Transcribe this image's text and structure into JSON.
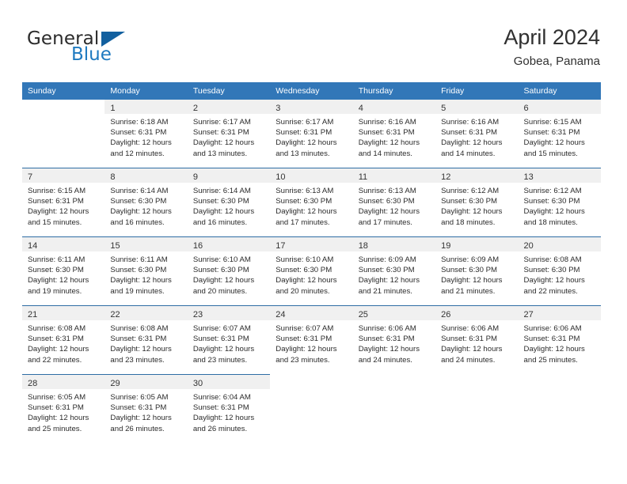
{
  "brand": {
    "name_part1": "General",
    "name_part2": "Blue",
    "triangle_color": "#12609f",
    "blue_color": "#1f7ac0"
  },
  "header": {
    "title": "April 2024",
    "subtitle": "Gobea, Panama"
  },
  "theme": {
    "header_bg": "#3277b8",
    "row_divider": "#2e6da4",
    "daynum_band": "#f0f0f0"
  },
  "columns": [
    "Sunday",
    "Monday",
    "Tuesday",
    "Wednesday",
    "Thursday",
    "Friday",
    "Saturday"
  ],
  "weeks": [
    [
      {
        "day": "",
        "lines": []
      },
      {
        "day": "1",
        "lines": [
          "Sunrise: 6:18 AM",
          "Sunset: 6:31 PM",
          "Daylight: 12 hours",
          "and 12 minutes."
        ]
      },
      {
        "day": "2",
        "lines": [
          "Sunrise: 6:17 AM",
          "Sunset: 6:31 PM",
          "Daylight: 12 hours",
          "and 13 minutes."
        ]
      },
      {
        "day": "3",
        "lines": [
          "Sunrise: 6:17 AM",
          "Sunset: 6:31 PM",
          "Daylight: 12 hours",
          "and 13 minutes."
        ]
      },
      {
        "day": "4",
        "lines": [
          "Sunrise: 6:16 AM",
          "Sunset: 6:31 PM",
          "Daylight: 12 hours",
          "and 14 minutes."
        ]
      },
      {
        "day": "5",
        "lines": [
          "Sunrise: 6:16 AM",
          "Sunset: 6:31 PM",
          "Daylight: 12 hours",
          "and 14 minutes."
        ]
      },
      {
        "day": "6",
        "lines": [
          "Sunrise: 6:15 AM",
          "Sunset: 6:31 PM",
          "Daylight: 12 hours",
          "and 15 minutes."
        ]
      }
    ],
    [
      {
        "day": "7",
        "lines": [
          "Sunrise: 6:15 AM",
          "Sunset: 6:31 PM",
          "Daylight: 12 hours",
          "and 15 minutes."
        ]
      },
      {
        "day": "8",
        "lines": [
          "Sunrise: 6:14 AM",
          "Sunset: 6:30 PM",
          "Daylight: 12 hours",
          "and 16 minutes."
        ]
      },
      {
        "day": "9",
        "lines": [
          "Sunrise: 6:14 AM",
          "Sunset: 6:30 PM",
          "Daylight: 12 hours",
          "and 16 minutes."
        ]
      },
      {
        "day": "10",
        "lines": [
          "Sunrise: 6:13 AM",
          "Sunset: 6:30 PM",
          "Daylight: 12 hours",
          "and 17 minutes."
        ]
      },
      {
        "day": "11",
        "lines": [
          "Sunrise: 6:13 AM",
          "Sunset: 6:30 PM",
          "Daylight: 12 hours",
          "and 17 minutes."
        ]
      },
      {
        "day": "12",
        "lines": [
          "Sunrise: 6:12 AM",
          "Sunset: 6:30 PM",
          "Daylight: 12 hours",
          "and 18 minutes."
        ]
      },
      {
        "day": "13",
        "lines": [
          "Sunrise: 6:12 AM",
          "Sunset: 6:30 PM",
          "Daylight: 12 hours",
          "and 18 minutes."
        ]
      }
    ],
    [
      {
        "day": "14",
        "lines": [
          "Sunrise: 6:11 AM",
          "Sunset: 6:30 PM",
          "Daylight: 12 hours",
          "and 19 minutes."
        ]
      },
      {
        "day": "15",
        "lines": [
          "Sunrise: 6:11 AM",
          "Sunset: 6:30 PM",
          "Daylight: 12 hours",
          "and 19 minutes."
        ]
      },
      {
        "day": "16",
        "lines": [
          "Sunrise: 6:10 AM",
          "Sunset: 6:30 PM",
          "Daylight: 12 hours",
          "and 20 minutes."
        ]
      },
      {
        "day": "17",
        "lines": [
          "Sunrise: 6:10 AM",
          "Sunset: 6:30 PM",
          "Daylight: 12 hours",
          "and 20 minutes."
        ]
      },
      {
        "day": "18",
        "lines": [
          "Sunrise: 6:09 AM",
          "Sunset: 6:30 PM",
          "Daylight: 12 hours",
          "and 21 minutes."
        ]
      },
      {
        "day": "19",
        "lines": [
          "Sunrise: 6:09 AM",
          "Sunset: 6:30 PM",
          "Daylight: 12 hours",
          "and 21 minutes."
        ]
      },
      {
        "day": "20",
        "lines": [
          "Sunrise: 6:08 AM",
          "Sunset: 6:30 PM",
          "Daylight: 12 hours",
          "and 22 minutes."
        ]
      }
    ],
    [
      {
        "day": "21",
        "lines": [
          "Sunrise: 6:08 AM",
          "Sunset: 6:31 PM",
          "Daylight: 12 hours",
          "and 22 minutes."
        ]
      },
      {
        "day": "22",
        "lines": [
          "Sunrise: 6:08 AM",
          "Sunset: 6:31 PM",
          "Daylight: 12 hours",
          "and 23 minutes."
        ]
      },
      {
        "day": "23",
        "lines": [
          "Sunrise: 6:07 AM",
          "Sunset: 6:31 PM",
          "Daylight: 12 hours",
          "and 23 minutes."
        ]
      },
      {
        "day": "24",
        "lines": [
          "Sunrise: 6:07 AM",
          "Sunset: 6:31 PM",
          "Daylight: 12 hours",
          "and 23 minutes."
        ]
      },
      {
        "day": "25",
        "lines": [
          "Sunrise: 6:06 AM",
          "Sunset: 6:31 PM",
          "Daylight: 12 hours",
          "and 24 minutes."
        ]
      },
      {
        "day": "26",
        "lines": [
          "Sunrise: 6:06 AM",
          "Sunset: 6:31 PM",
          "Daylight: 12 hours",
          "and 24 minutes."
        ]
      },
      {
        "day": "27",
        "lines": [
          "Sunrise: 6:06 AM",
          "Sunset: 6:31 PM",
          "Daylight: 12 hours",
          "and 25 minutes."
        ]
      }
    ],
    [
      {
        "day": "28",
        "lines": [
          "Sunrise: 6:05 AM",
          "Sunset: 6:31 PM",
          "Daylight: 12 hours",
          "and 25 minutes."
        ]
      },
      {
        "day": "29",
        "lines": [
          "Sunrise: 6:05 AM",
          "Sunset: 6:31 PM",
          "Daylight: 12 hours",
          "and 26 minutes."
        ]
      },
      {
        "day": "30",
        "lines": [
          "Sunrise: 6:04 AM",
          "Sunset: 6:31 PM",
          "Daylight: 12 hours",
          "and 26 minutes."
        ]
      },
      {
        "day": "",
        "lines": []
      },
      {
        "day": "",
        "lines": []
      },
      {
        "day": "",
        "lines": []
      },
      {
        "day": "",
        "lines": []
      }
    ]
  ]
}
